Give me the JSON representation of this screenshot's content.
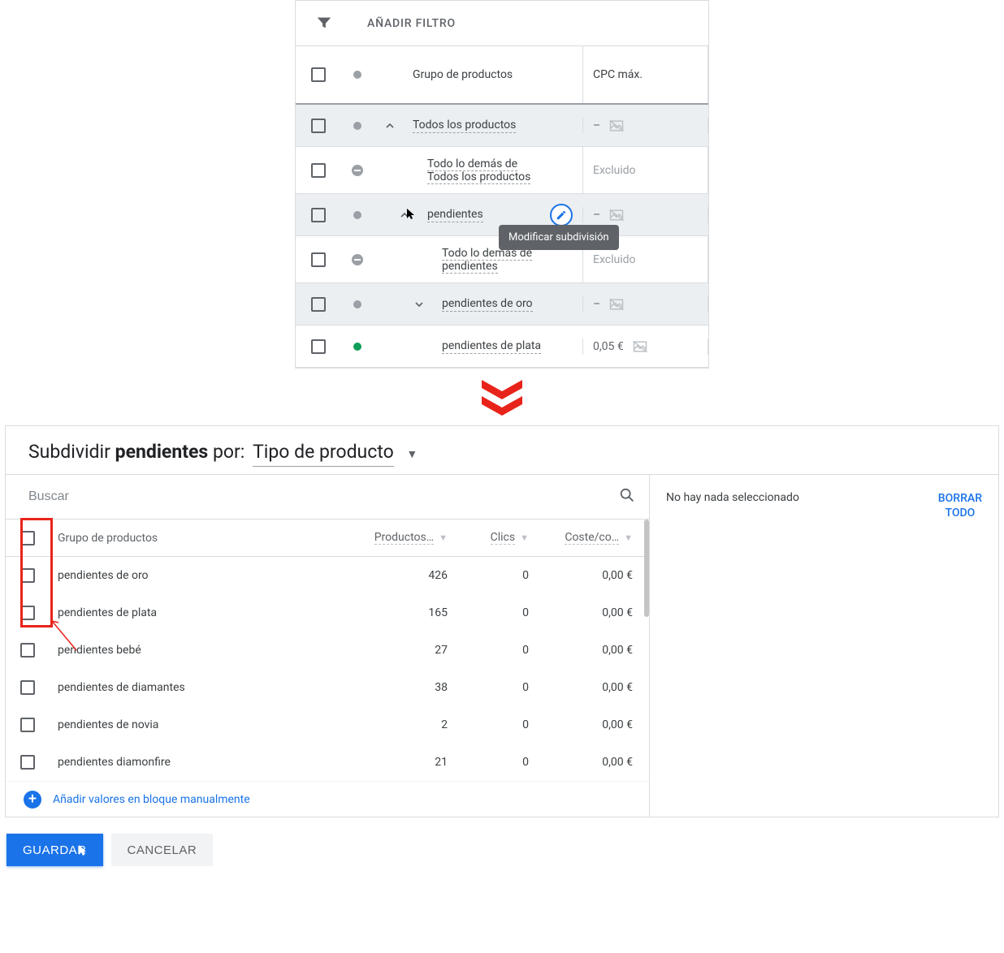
{
  "filter": {
    "label": "AÑADIR FILTRO"
  },
  "header": {
    "product_group": "Grupo de productos",
    "cpc_max": "CPC máx."
  },
  "rows": [
    {
      "name": "Todos los productos",
      "cpc": "–",
      "status": "grey",
      "expand": "up",
      "shaded": true,
      "indent": 0,
      "icon": true,
      "multiline": false
    },
    {
      "name": "Todo lo demás de\nTodos los productos",
      "cpc": "Excluido",
      "status": "excluded",
      "expand": "none",
      "shaded": false,
      "indent": 1,
      "icon": false,
      "multiline": true
    },
    {
      "name": "pendientes",
      "cpc": "–",
      "status": "grey",
      "expand": "up",
      "shaded": true,
      "indent": 1,
      "icon": true,
      "multiline": false,
      "edit": true
    },
    {
      "name": "Todo lo demás de\npendientes",
      "cpc": "Excluido",
      "status": "excluded",
      "expand": "none",
      "shaded": false,
      "indent": 2,
      "icon": false,
      "multiline": true
    },
    {
      "name": "pendientes de oro",
      "cpc": "–",
      "status": "grey",
      "expand": "down",
      "shaded": true,
      "indent": 2,
      "icon": true,
      "multiline": false
    },
    {
      "name": "pendientes de plata",
      "cpc": "0,05 €",
      "status": "green",
      "expand": "none",
      "shaded": false,
      "indent": 2,
      "icon": true,
      "multiline": false
    }
  ],
  "tooltip": "Modificar subdivisión",
  "subdivide": {
    "title_prefix": "Subdividir ",
    "title_bold": "pendientes",
    "title_mid": " por: ",
    "dropdown": "Tipo de producto",
    "search_placeholder": "Buscar",
    "selection_empty": "No hay nada seleccionado",
    "clear_all": "BORRAR\nTODO",
    "columns": {
      "group": "Grupo de productos",
      "products": "Productos…",
      "clicks": "Clics",
      "cost": "Coste/co…"
    },
    "items": [
      {
        "name": "pendientes de oro",
        "products": "426",
        "clicks": "0",
        "cost": "0,00 €"
      },
      {
        "name": "pendientes de plata",
        "products": "165",
        "clicks": "0",
        "cost": "0,00 €"
      },
      {
        "name": "pendientes bebé",
        "products": "27",
        "clicks": "0",
        "cost": "0,00 €"
      },
      {
        "name": "pendientes de diamantes",
        "products": "38",
        "clicks": "0",
        "cost": "0,00 €"
      },
      {
        "name": "pendientes de novia",
        "products": "2",
        "clicks": "0",
        "cost": "0,00 €"
      },
      {
        "name": "pendientes diamonfire",
        "products": "21",
        "clicks": "0",
        "cost": "0,00 €"
      }
    ],
    "bulk_add": "Añadir valores en bloque manualmente",
    "save": "GUARDAR",
    "cancel": "CANCELAR"
  }
}
